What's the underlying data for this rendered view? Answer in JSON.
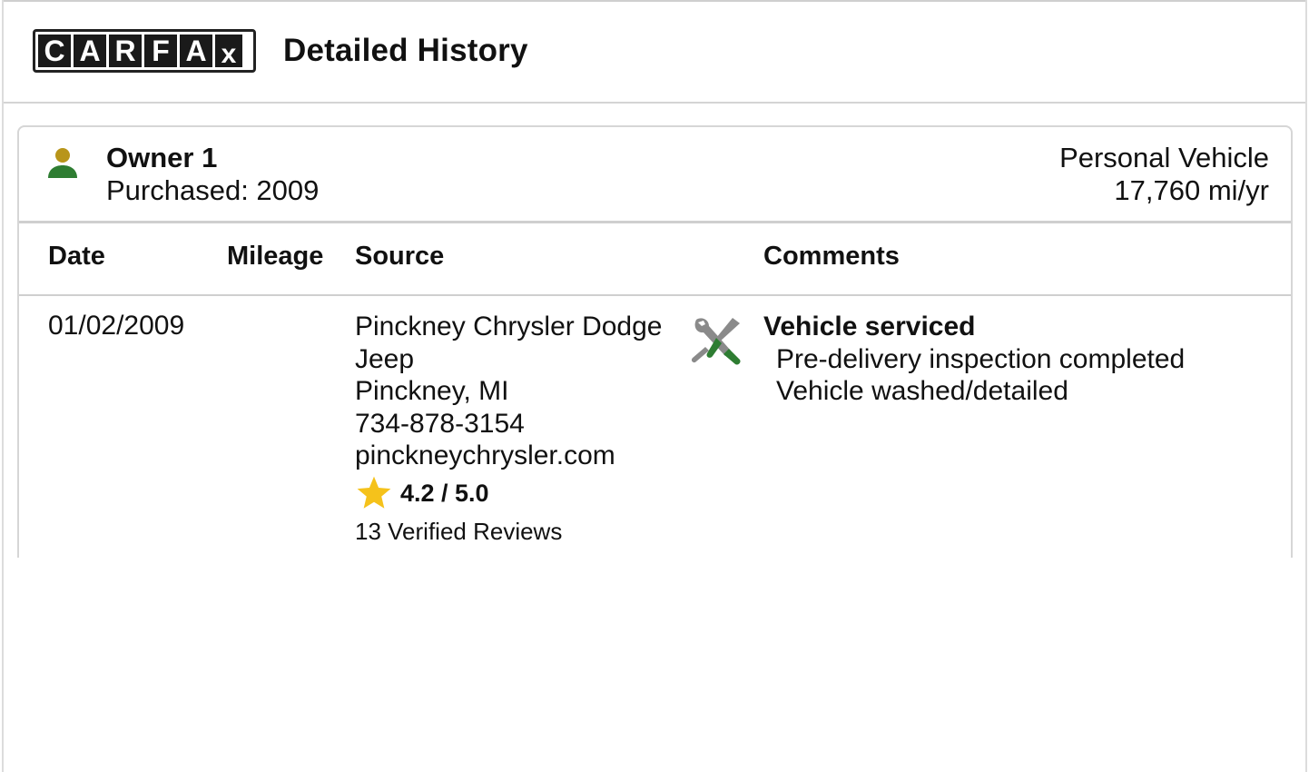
{
  "header": {
    "logo_letters": [
      "C",
      "A",
      "R",
      "F",
      "A",
      "X"
    ],
    "title": "Detailed History"
  },
  "owner": {
    "name": "Owner 1",
    "purchased": "Purchased: 2009",
    "vehicle_type": "Personal Vehicle",
    "mileage_rate": "17,760 mi/yr",
    "icon": "person-icon",
    "colors": {
      "head": "#b8951a",
      "body": "#2e7d32"
    }
  },
  "table": {
    "columns": {
      "date": "Date",
      "mileage": "Mileage",
      "source": "Source",
      "comments": "Comments"
    },
    "rows": [
      {
        "date": "01/02/2009",
        "mileage": "",
        "source_lines": [
          "Pinckney Chrysler Dodge",
          "Jeep",
          "Pinckney, MI",
          "734-878-3154",
          "pinckneychrysler.com"
        ],
        "rating": "4.2 / 5.0",
        "reviews": "13 Verified Reviews",
        "icon": "service-wrench-icon",
        "comment_title": "Vehicle serviced",
        "comment_lines": [
          "Pre-delivery inspection completed",
          "Vehicle washed/detailed"
        ]
      }
    ]
  },
  "colors": {
    "star": "#f5c21b",
    "tool_gray": "#8a8a8a",
    "tool_green": "#2e7d32"
  }
}
